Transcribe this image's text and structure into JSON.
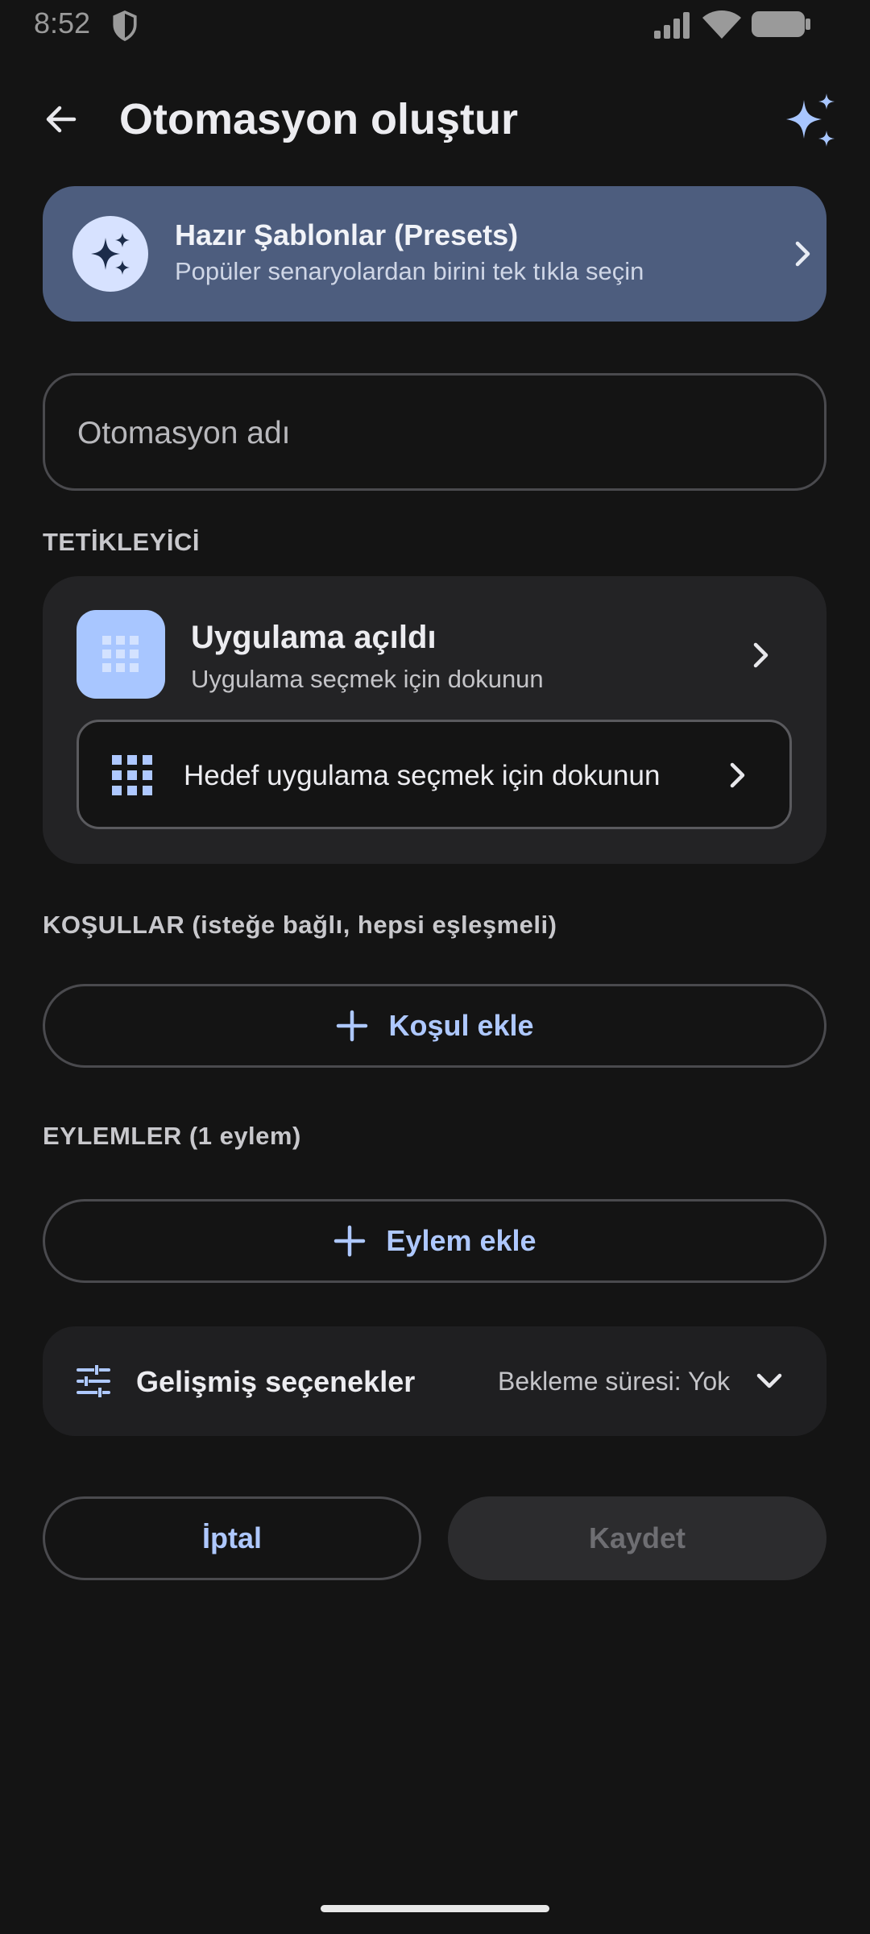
{
  "status_bar": {
    "time": "8:52"
  },
  "app_bar": {
    "title": "Otomasyon oluştur"
  },
  "presets": {
    "title": "Hazır Şablonlar (Presets)",
    "subtitle": "Popüler senaryolardan birini tek tıkla seçin"
  },
  "name_field": {
    "placeholder": "Otomasyon adı",
    "value": ""
  },
  "trigger_section": {
    "label": "TETİKLEYİCİ",
    "title": "Uygulama açıldı",
    "subtitle": "Uygulama seçmek için dokunun",
    "target_button_label": "Hedef uygulama seçmek için dokunun"
  },
  "conditions_section": {
    "label": "KOŞULLAR (isteğe bağlı, hepsi eşleşmeli)",
    "add_label": "Koşul ekle"
  },
  "actions_section": {
    "label": "EYLEMLER (1 eylem)",
    "add_label": "Eylem ekle"
  },
  "advanced": {
    "title": "Gelişmiş seçenekler",
    "value": "Bekleme süresi: Yok"
  },
  "buttons": {
    "cancel": "İptal",
    "save": "Kaydet"
  },
  "colors": {
    "background": "#141414",
    "accent": "#aec8ff",
    "presets_card": "#4d5d7e",
    "trigger_icon_bg": "#a8c6ff"
  }
}
